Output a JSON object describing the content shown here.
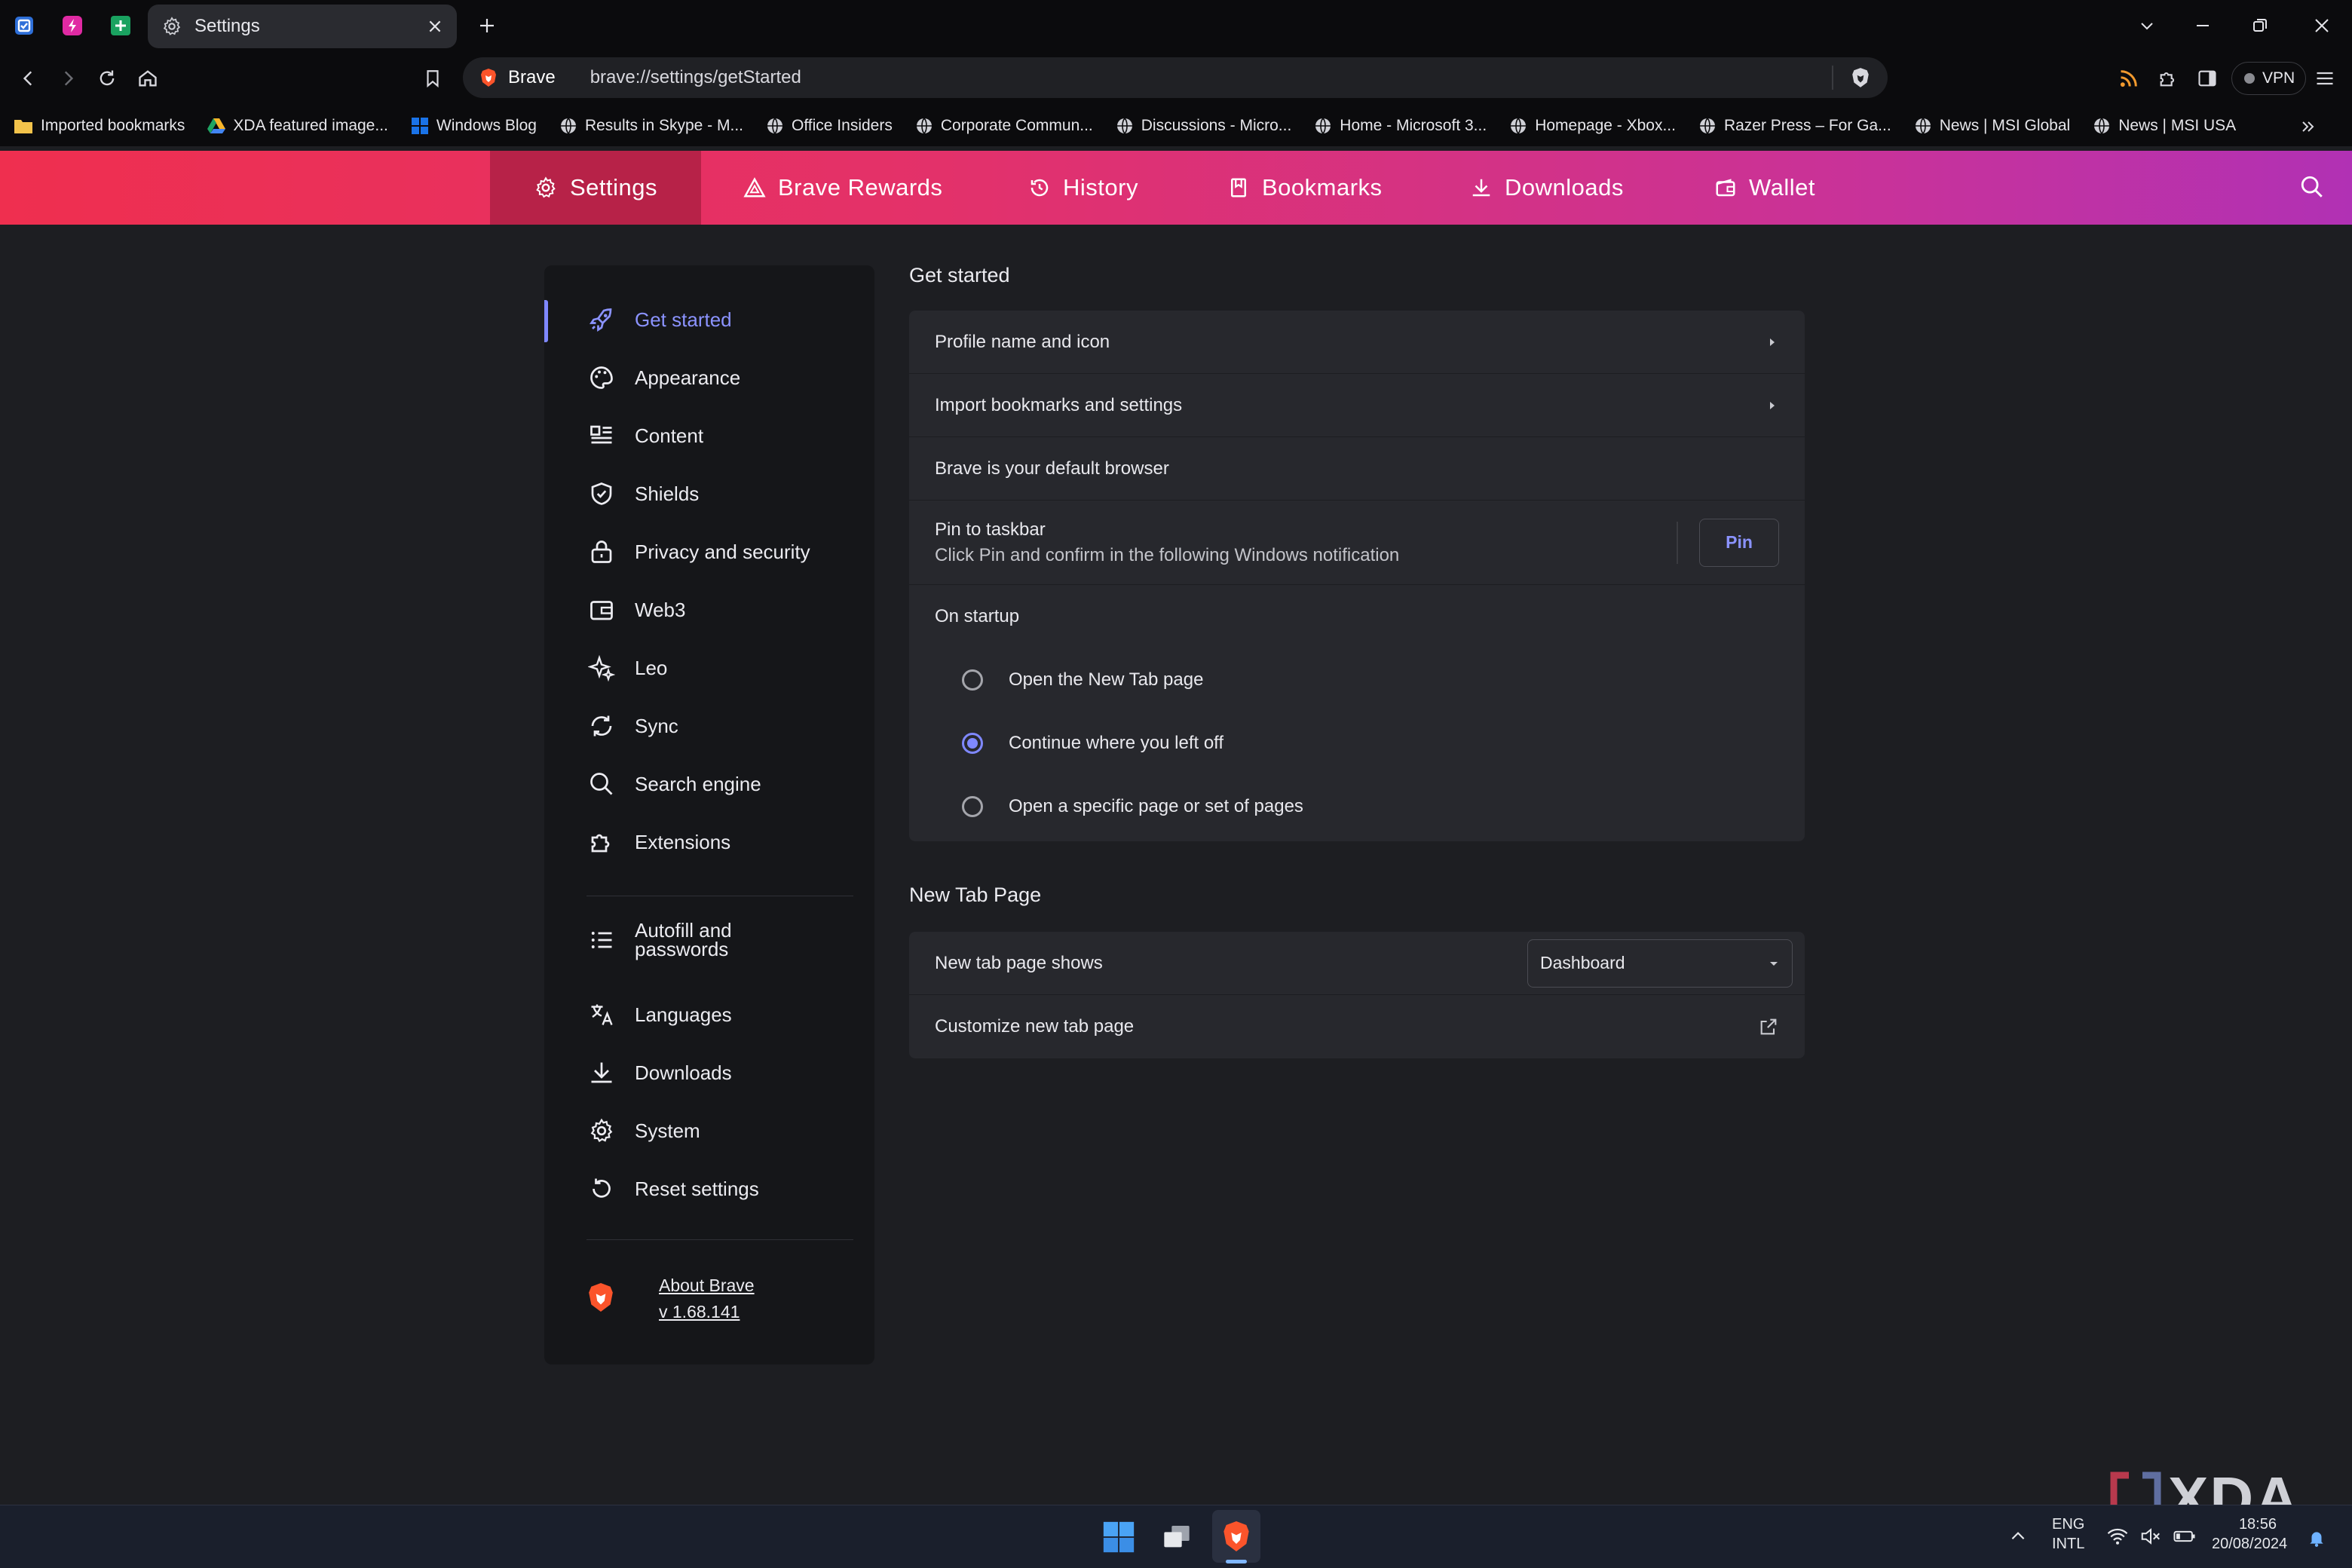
{
  "tabs": {
    "active_title": "Settings"
  },
  "toolbar": {
    "brand": "Brave",
    "url": "brave://settings/getStarted",
    "vpn": "VPN"
  },
  "bookmarks": [
    "Imported bookmarks",
    "XDA featured image...",
    "Windows Blog",
    "Results in Skype - M...",
    "Office Insiders",
    "Corporate Commun...",
    "Discussions - Micro...",
    "Home - Microsoft 3...",
    "Homepage - Xbox...",
    "Razer Press – For Ga...",
    "News | MSI Global",
    "News | MSI USA"
  ],
  "nav": {
    "settings": "Settings",
    "rewards": "Brave Rewards",
    "history": "History",
    "bookmarks": "Bookmarks",
    "downloads": "Downloads",
    "wallet": "Wallet"
  },
  "sidebar": {
    "items": [
      "Get started",
      "Appearance",
      "Content",
      "Shields",
      "Privacy and security",
      "Web3",
      "Leo",
      "Sync",
      "Search engine",
      "Extensions"
    ],
    "items2": [
      "Autofill and passwords",
      "Languages",
      "Downloads",
      "System",
      "Reset settings"
    ],
    "about": "About Brave",
    "version": "v 1.68.141"
  },
  "get_started": {
    "title": "Get started",
    "profile": "Profile name and icon",
    "import": "Import bookmarks and settings",
    "default": "Brave is your default browser",
    "pin_title": "Pin to taskbar",
    "pin_sub": "Click Pin and confirm in the following Windows notification",
    "pin_btn": "Pin",
    "startup": "On startup",
    "opt1": "Open the New Tab page",
    "opt2": "Continue where you left off",
    "opt3": "Open a specific page or set of pages",
    "selected_option": 2
  },
  "ntp": {
    "title": "New Tab Page",
    "shows": "New tab page shows",
    "select_value": "Dashboard",
    "customize": "Customize new tab page"
  },
  "taskbar": {
    "lang1": "ENG",
    "lang2": "INTL",
    "time": "18:56",
    "date": "20/08/2024"
  },
  "watermark": "XDA",
  "colors": {
    "accent": "#7f88ff",
    "brand_start": "#ef2f4f",
    "brand_end": "#b131b4"
  }
}
